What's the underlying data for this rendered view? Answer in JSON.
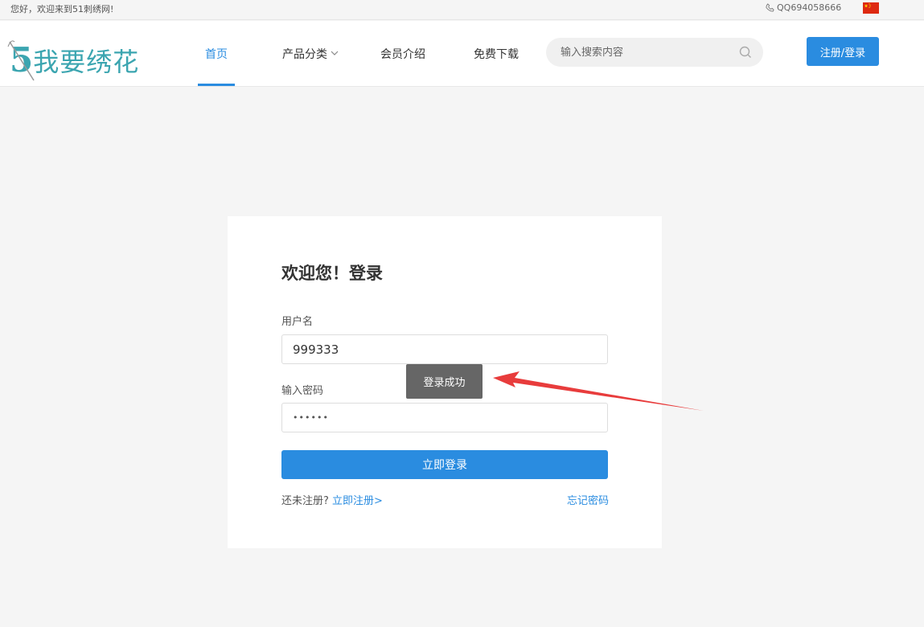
{
  "topbar": {
    "welcome": "您好，欢迎来到51刺绣网!",
    "contact": "QQ694058666",
    "phone_icon": "phone-icon",
    "flag_icon": "china-flag-icon"
  },
  "header": {
    "logo_digit": "5",
    "logo_text": "我要绣花",
    "nav": [
      {
        "label": "首页",
        "active": true
      },
      {
        "label": "产品分类",
        "active": false,
        "has_dropdown": true
      },
      {
        "label": "会员介绍",
        "active": false
      },
      {
        "label": "免费下载",
        "active": false
      }
    ],
    "search_placeholder": "输入搜索内容",
    "register_login_label": "注册/登录"
  },
  "login": {
    "title": "欢迎您！登录",
    "username_label": "用户名",
    "username_value": "999333",
    "password_label": "输入密码",
    "password_value": "••••••",
    "submit_label": "立即登录",
    "no_account_text": "还未注册?",
    "register_link": "立即注册>",
    "forgot_link": "忘记密码"
  },
  "toast": {
    "message": "登录成功"
  },
  "colors": {
    "accent": "#2a8ce0",
    "logo": "#3ba5b0",
    "toast_bg": "#666666",
    "annotation_arrow": "#e83c3c"
  }
}
